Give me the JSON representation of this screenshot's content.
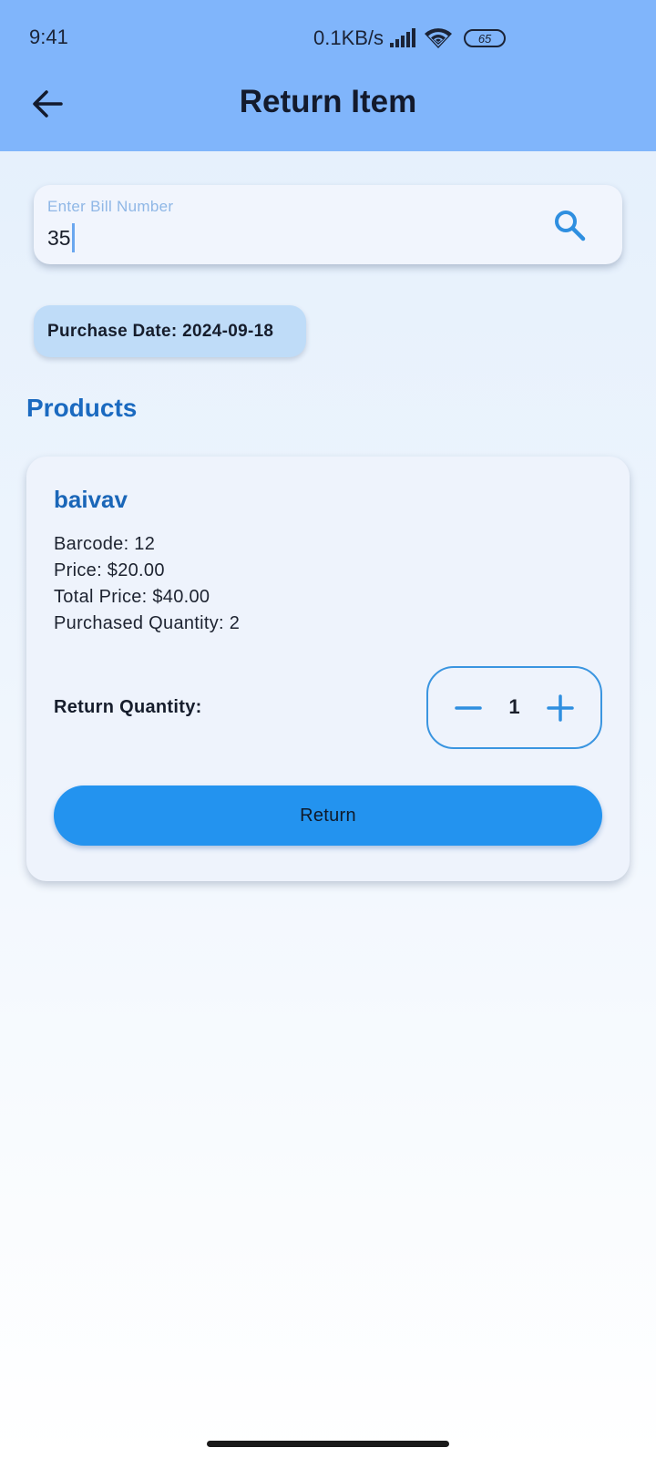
{
  "status_bar": {
    "time": "9:41",
    "network_speed": "0.1KB/s",
    "battery_level": "65"
  },
  "header": {
    "title": "Return Item",
    "back_icon": "arrow-left-icon"
  },
  "search": {
    "label": "Enter Bill Number",
    "value": "35",
    "icon": "search-icon"
  },
  "purchase_date": "Purchase Date: 2024-09-18",
  "products_section": {
    "title": "Products",
    "items": [
      {
        "name": "baivav",
        "barcode": "Barcode: 12",
        "price": "Price: $20.00",
        "total_price": "Total Price: $40.00",
        "purchased_quantity": "Purchased Quantity: 2",
        "return_quantity_label": "Return Quantity:",
        "return_quantity": "1",
        "return_button_label": "Return"
      }
    ]
  },
  "colors": {
    "app_bar": "#80b5fb",
    "accent": "#2393ef",
    "title_blue": "#1b6ac0"
  }
}
